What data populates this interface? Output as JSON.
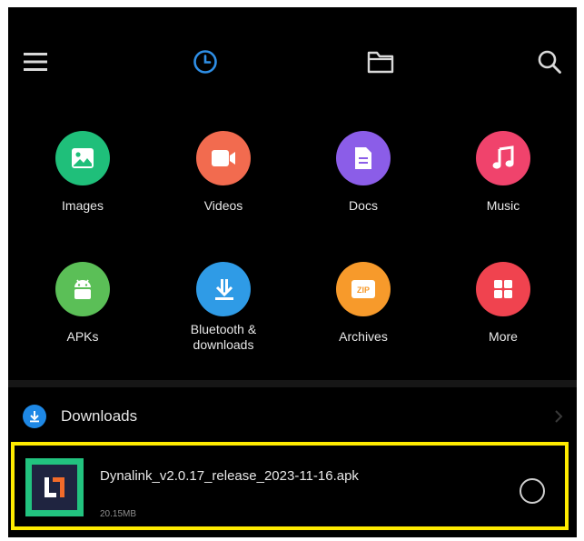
{
  "topbar": {
    "icons": [
      "menu-icon",
      "recent-clock-icon",
      "folder-icon",
      "search-icon"
    ],
    "active_color": "#2f8fe6",
    "icon_color": "#d9d9d9"
  },
  "categories": [
    {
      "label": "Images",
      "color": "#1fbf7a",
      "icon": "image-icon"
    },
    {
      "label": "Videos",
      "color": "#f26b4f",
      "icon": "video-icon"
    },
    {
      "label": "Docs",
      "color": "#8b5de8",
      "icon": "document-icon"
    },
    {
      "label": "Music",
      "color": "#f0436c",
      "icon": "music-note-icon"
    },
    {
      "label": "APKs",
      "color": "#5bbf57",
      "icon": "android-icon"
    },
    {
      "label": "Bluetooth & downloads",
      "color": "#2f9be6",
      "icon": "download-icon"
    },
    {
      "label": "Archives",
      "color": "#f79a2b",
      "icon": "zip-icon",
      "badge": "ZIP"
    },
    {
      "label": "More",
      "color": "#f0434f",
      "icon": "grid-icon"
    }
  ],
  "section": {
    "title": "Downloads",
    "icon": "download-circle-icon",
    "color": "#1e88e5"
  },
  "file": {
    "name": "Dynalink_v2.0.17_release_2023-11-16.apk",
    "size": "20.15MB",
    "highlight_color": "#ffeb00",
    "thumb_color": "#22c37f"
  }
}
